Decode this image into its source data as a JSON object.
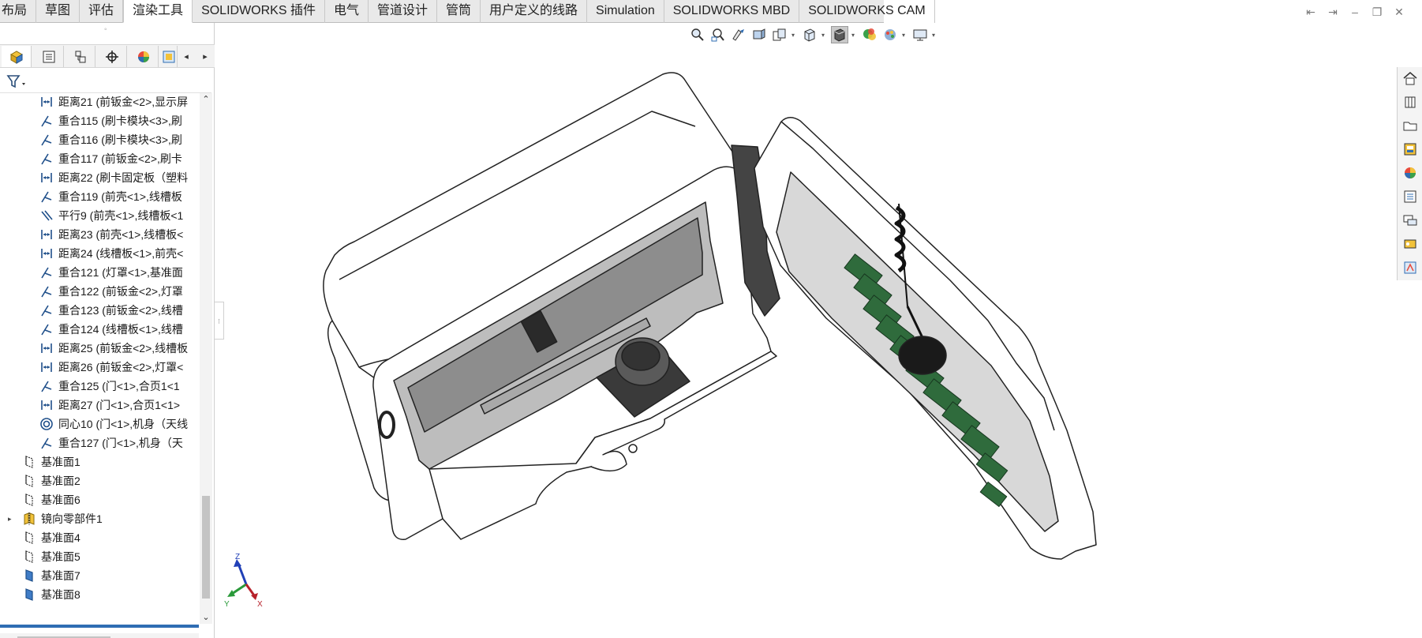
{
  "ribbon_tabs": [
    "布局",
    "草图",
    "评估",
    "渲染工具",
    "SOLIDWORKS 插件",
    "电气",
    "管道设计",
    "管筒",
    "用户定义的线路",
    "Simulation",
    "SOLIDWORKS MBD",
    "SOLIDWORKS CAM"
  ],
  "active_tab": "渲染工具",
  "tree": {
    "items": [
      {
        "type": "distance",
        "label": "距离21 (前钣金<2>,显示屏"
      },
      {
        "type": "coincident",
        "label": "重合115 (刷卡模块<3>,刷"
      },
      {
        "type": "coincident",
        "label": "重合116 (刷卡模块<3>,刷"
      },
      {
        "type": "coincident",
        "label": "重合117 (前钣金<2>,刷卡"
      },
      {
        "type": "distance",
        "label": "距离22 (刷卡固定板（塑料"
      },
      {
        "type": "coincident",
        "label": "重合119 (前壳<1>,线槽板"
      },
      {
        "type": "parallel",
        "label": "平行9 (前壳<1>,线槽板<1"
      },
      {
        "type": "distance",
        "label": "距离23 (前壳<1>,线槽板<"
      },
      {
        "type": "distance",
        "label": "距离24 (线槽板<1>,前壳<"
      },
      {
        "type": "coincident",
        "label": "重合121 (灯罩<1>,基准面"
      },
      {
        "type": "coincident",
        "label": "重合122 (前钣金<2>,灯罩"
      },
      {
        "type": "coincident",
        "label": "重合123 (前钣金<2>,线槽"
      },
      {
        "type": "coincident",
        "label": "重合124 (线槽板<1>,线槽"
      },
      {
        "type": "distance",
        "label": "距离25 (前钣金<2>,线槽板"
      },
      {
        "type": "distance",
        "label": "距离26 (前钣金<2>,灯罩<"
      },
      {
        "type": "coincident",
        "label": "重合125 (门<1>,合页1<1"
      },
      {
        "type": "distance",
        "label": "距离27 (门<1>,合页1<1>"
      },
      {
        "type": "concentric",
        "label": "同心10 (门<1>,机身（天线"
      },
      {
        "type": "coincident",
        "label": "重合127 (门<1>,机身（天"
      },
      {
        "type": "plane",
        "label": "基准面1"
      },
      {
        "type": "plane",
        "label": "基准面2"
      },
      {
        "type": "plane",
        "label": "基准面6"
      },
      {
        "type": "mirror",
        "label": "镜向零部件1"
      },
      {
        "type": "plane",
        "label": "基准面4"
      },
      {
        "type": "plane",
        "label": "基准面5"
      },
      {
        "type": "plane-solid",
        "label": "基准面7"
      },
      {
        "type": "plane-solid",
        "label": "基准面8"
      }
    ]
  },
  "triad": {
    "x": "X",
    "y": "Y",
    "z": "Z"
  },
  "colors": {
    "accent": "#2f6db3",
    "board_green": "#2f6b3c",
    "icon_blue": "#2f6db3"
  }
}
